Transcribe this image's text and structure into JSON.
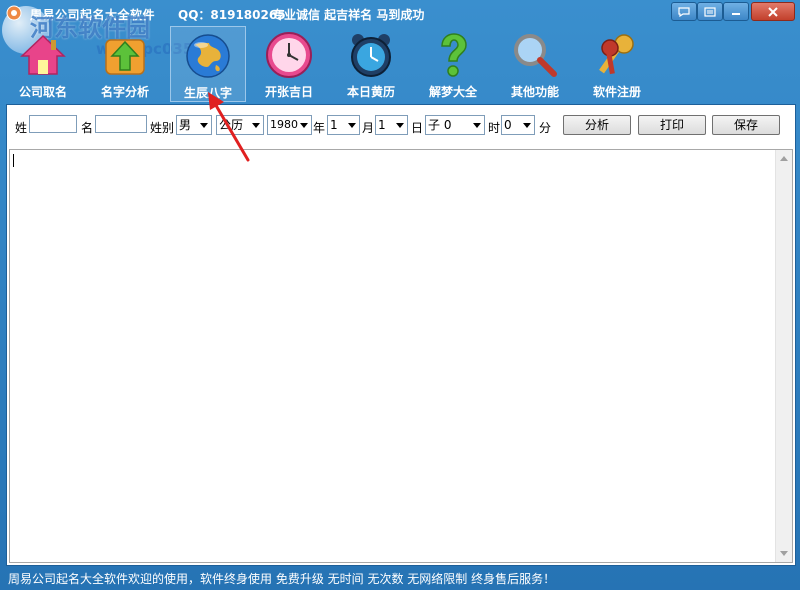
{
  "titlebar": {
    "title": "周易公司起名大全软件",
    "qq": "QQ：819180265",
    "slogan": "专业诚信  起吉祥名  马到成功",
    "watermark": "河东软件园",
    "watermark_url": "www.pc0359.cn"
  },
  "toolbar": {
    "items": [
      {
        "label": "公司取名",
        "icon": "house-icon"
      },
      {
        "label": "名字分析",
        "icon": "upload-arrow-icon"
      },
      {
        "label": "生辰八字",
        "icon": "globe-icon"
      },
      {
        "label": "开张吉日",
        "icon": "clock-icon"
      },
      {
        "label": "本日黄历",
        "icon": "alarm-clock-icon"
      },
      {
        "label": "解梦大全",
        "icon": "question-icon"
      },
      {
        "label": "其他功能",
        "icon": "magnifier-icon"
      },
      {
        "label": "软件注册",
        "icon": "keys-icon"
      }
    ],
    "active_index": 2
  },
  "form": {
    "surname_label": "姓",
    "surname_value": "",
    "name_label": "名",
    "name_value": "",
    "gender_label": "姓别",
    "gender_value": "男",
    "calendar_value": "公历",
    "year_value": "1980",
    "year_label": "年",
    "month_value": "1",
    "month_label": "月",
    "day_value": "1",
    "day_label": "日",
    "hour_value": "子 0",
    "hour_label": "时",
    "minute_value": "0",
    "minute_label": "分",
    "analyze_button": "分析",
    "print_button": "打印",
    "save_button": "保存"
  },
  "status": {
    "text": "周易公司起名大全软件欢迎的使用，软件终身使用  免费升级  无时间  无次数  无网络限制  终身售后服务！"
  },
  "colors": {
    "window_blue": "#2f7fbd",
    "annotation_red": "#e02020"
  }
}
